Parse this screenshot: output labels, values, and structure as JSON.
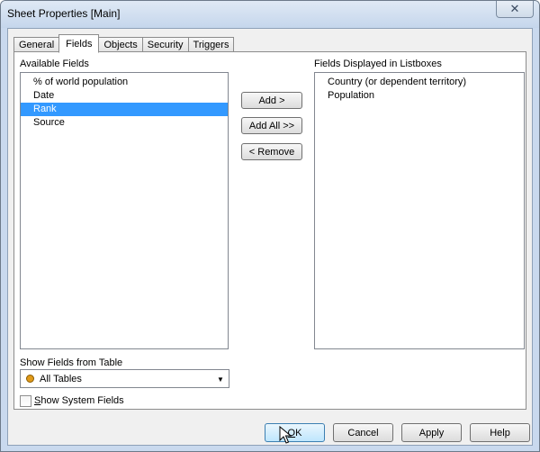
{
  "window": {
    "title": "Sheet Properties [Main]",
    "close_glyph": "✕"
  },
  "tabs": [
    {
      "label": "General",
      "active": false
    },
    {
      "label": "Fields",
      "active": true
    },
    {
      "label": "Objects",
      "active": false
    },
    {
      "label": "Security",
      "active": false
    },
    {
      "label": "Triggers",
      "active": false
    }
  ],
  "available_fields": {
    "label": "Available Fields",
    "items": [
      "% of world population",
      "Date",
      "Rank",
      "Source"
    ],
    "selected_index": 2
  },
  "displayed_fields": {
    "label": "Fields Displayed in Listboxes",
    "items": [
      "Country (or dependent territory)",
      "Population"
    ]
  },
  "transfer_buttons": {
    "add": "Add >",
    "add_all": "Add All >>",
    "remove": "< Remove"
  },
  "show_from_table": {
    "label": "Show Fields from Table",
    "selected": "All Tables",
    "dot_color": "#e09a1a"
  },
  "show_system_fields": {
    "label_accel": "S",
    "label_rest": "how System Fields",
    "checked": false
  },
  "dialog_buttons": {
    "ok_accel": "O",
    "ok_rest": "K",
    "cancel": "Cancel",
    "apply": "Apply",
    "help": "Help"
  }
}
